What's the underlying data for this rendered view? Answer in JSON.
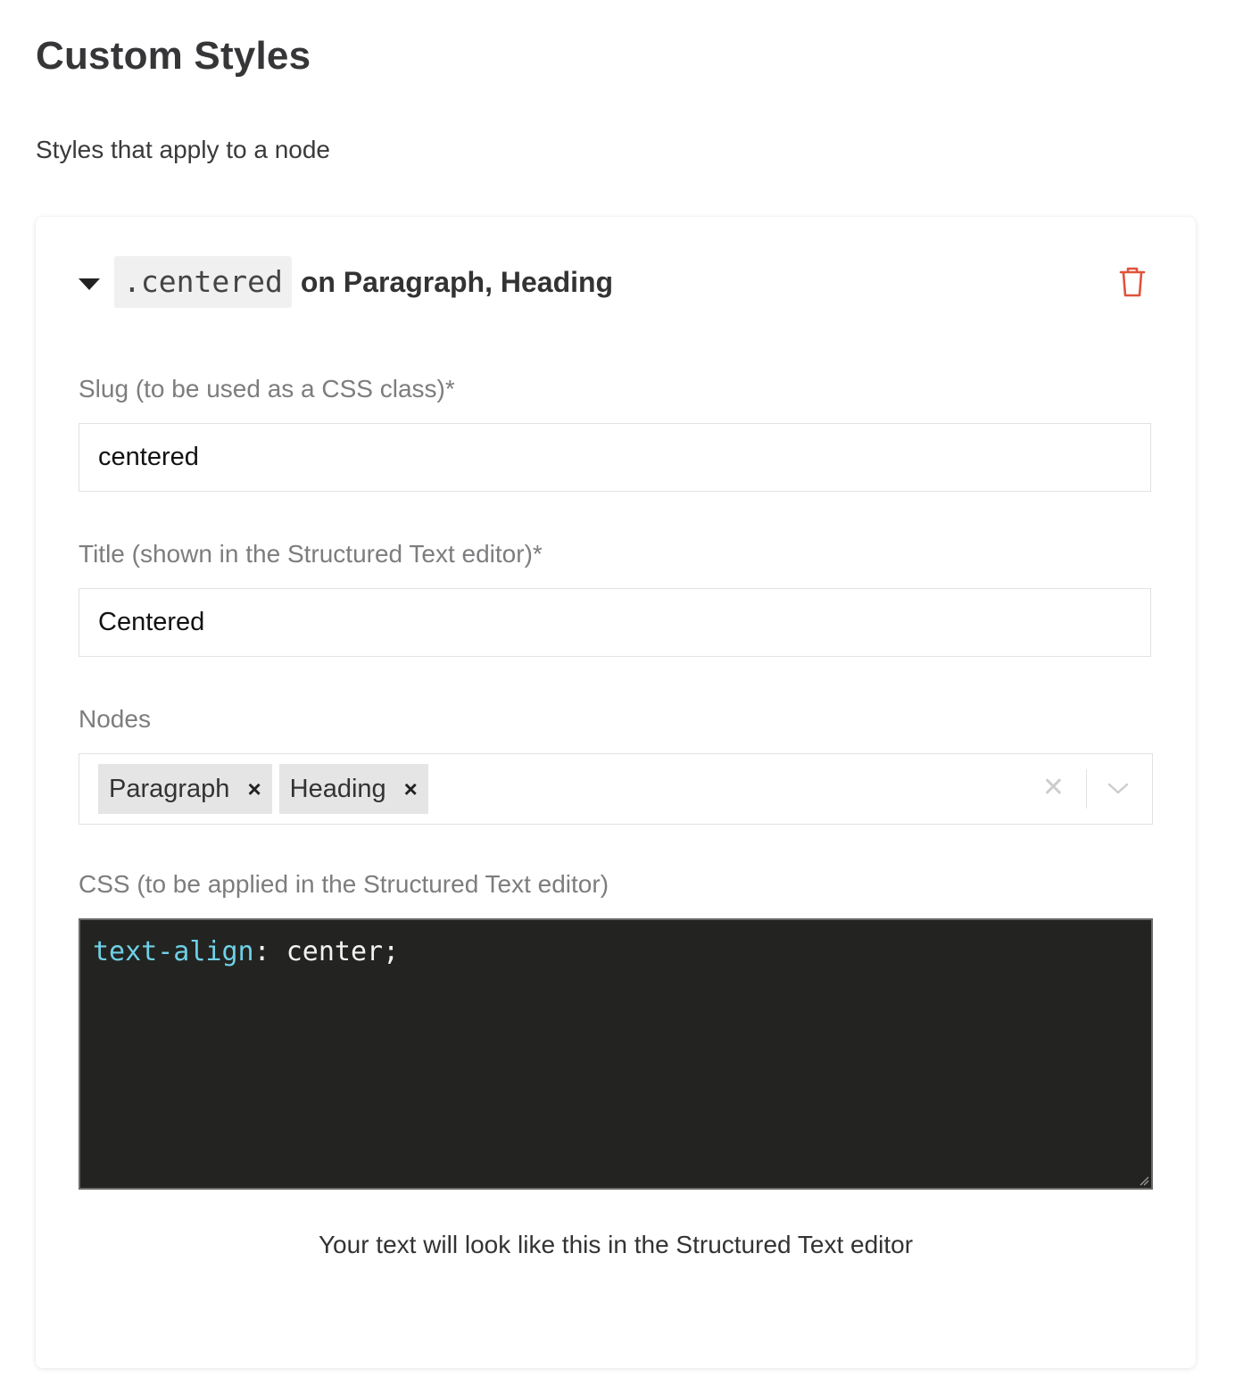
{
  "page": {
    "title": "Custom Styles",
    "subtitle": "Styles that apply to a node"
  },
  "style_card": {
    "slug_display": ".centered",
    "applies_to_text": "on Paragraph, Heading",
    "fields": {
      "slug": {
        "label": "Slug (to be used as a CSS class)*",
        "value": "centered"
      },
      "title": {
        "label": "Title (shown in the Structured Text editor)*",
        "value": "Centered"
      },
      "nodes": {
        "label": "Nodes",
        "selected": [
          {
            "label": "Paragraph",
            "remove": "×"
          },
          {
            "label": "Heading",
            "remove": "×"
          }
        ],
        "clear": "✕"
      },
      "css": {
        "label": "CSS (to be applied in the Structured Text editor)",
        "property": "text-align",
        "separator": ": ",
        "value": "center;"
      }
    },
    "preview_text": "Your text will look like this in the Structured Text editor"
  },
  "colors": {
    "danger": "#e0533d",
    "code_bg": "#232421",
    "code_property": "#6fd0e6"
  },
  "icons": {
    "collapse": "caret-down-icon",
    "delete": "trash-icon",
    "dropdown": "chevron-down-icon"
  }
}
